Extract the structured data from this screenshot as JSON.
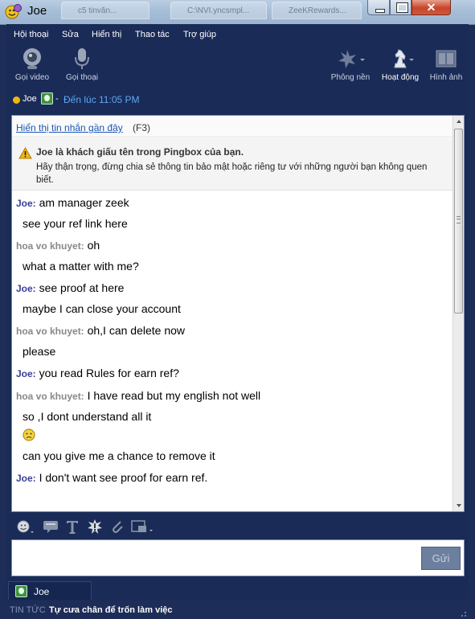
{
  "window": {
    "title": "Joe",
    "background_tabs": [
      "c5 tinvăn...",
      "C:\\NVI.yncsmpl...",
      "ZeeKRewards..."
    ]
  },
  "menu": [
    "Hội thoại",
    "Sửa",
    "Hiển thị",
    "Thao tác",
    "Trợ giúp"
  ],
  "toolbar": {
    "video_call": {
      "label": "Gọi video",
      "icon": "webcam-icon"
    },
    "voice_call": {
      "label": "Gọi thoại",
      "icon": "microphone-icon"
    },
    "background": {
      "label": "Phông nền",
      "icon": "leaf-icon"
    },
    "activities": {
      "label": "Hoạt động",
      "icon": "chess-knight-icon"
    },
    "picture": {
      "label": "Hình ảnh",
      "icon": "picture-icon"
    }
  },
  "status": {
    "name": "Joe",
    "separator": "-",
    "time_text": "Đến lúc 11:05 PM",
    "status_color": "#f2b612"
  },
  "conversation": {
    "recent_link": "Hiển thị tin nhắn gần đây",
    "recent_key": "(F3)",
    "warning_title": "Joe là khách giấu tên trong Pingbox của bạn.",
    "warning_text": "Hãy thận trọng, đừng chia sẻ thông tin bảo mật hoặc riêng tư với những người bạn không quen biết.",
    "messages": [
      {
        "sender": "Joe:",
        "text": "am manager zeek"
      },
      {
        "sender": "",
        "text": "see your ref link here"
      },
      {
        "sender": "hoa vo khuyet:",
        "text": "oh"
      },
      {
        "sender": "",
        "text": "what a matter with me?"
      },
      {
        "sender": "Joe:",
        "text": "see proof at here"
      },
      {
        "sender": "",
        "text": "maybe I can close your account"
      },
      {
        "sender": "hoa vo khuyet:",
        "text": "oh,I can delete now"
      },
      {
        "sender": "",
        "text": "please"
      },
      {
        "sender": "Joe:",
        "text": "you read Rules  for earn ref?"
      },
      {
        "sender": "hoa vo khuyet:",
        "text": "I have read but my english not well"
      },
      {
        "sender": "",
        "text": "so ,I dont understand all it"
      },
      {
        "sender": "",
        "text": "can you give me a chance to remove it"
      },
      {
        "sender": "Joe:",
        "text": "I don't want see proof for earn ref."
      }
    ]
  },
  "compose": {
    "send_label": "Gửi",
    "tools": [
      "emoticon-icon",
      "nudge-icon",
      "font-icon",
      "buzz-icon",
      "attach-icon",
      "screenshot-icon"
    ]
  },
  "bottom": {
    "tab_label": "Joe",
    "ticker_tag": "TIN TỨC",
    "ticker_text": "Tự cưa chân để trốn làm việc"
  }
}
